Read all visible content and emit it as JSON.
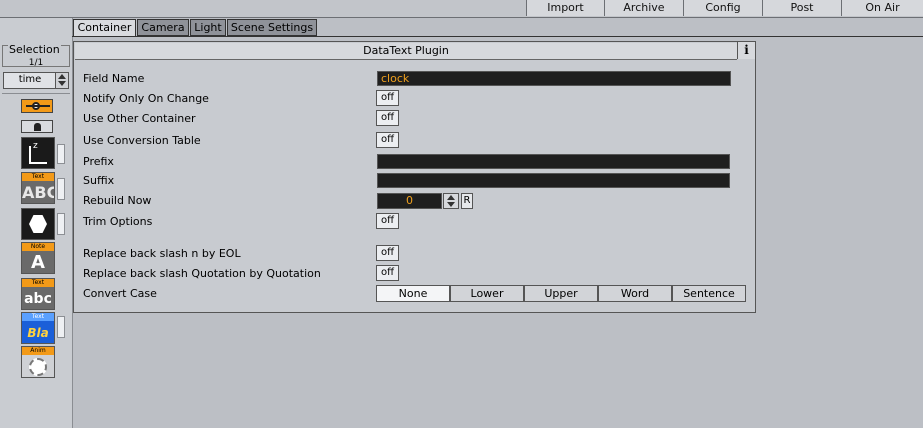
{
  "topbar": {
    "buttons": [
      "Import",
      "Archive",
      "Config",
      "Post",
      "On Air"
    ]
  },
  "left_panel": {
    "selection_label": "Selection",
    "selection_count": "1/1",
    "time_value": "time",
    "plugin_icons": [
      {
        "icon": "orange-key-icon"
      },
      {
        "icon": "container-icon"
      },
      {
        "icon": "axis-icon",
        "text": "z"
      },
      {
        "icon": "text-abc-icon",
        "tag": "Text",
        "text": "ABC"
      },
      {
        "icon": "hexagon-icon"
      },
      {
        "icon": "note-icon",
        "tag": "Note",
        "text": "A"
      },
      {
        "icon": "text-small-abc-icon",
        "tag": "Text",
        "text": "abc"
      },
      {
        "icon": "text-blabla-icon",
        "tag": "Text",
        "text": "Bla"
      },
      {
        "icon": "anim-icon",
        "tag": "Anim"
      }
    ]
  },
  "tabs": [
    {
      "label": "Container",
      "active": true
    },
    {
      "label": "Camera",
      "active": false
    },
    {
      "label": "Light",
      "active": false
    },
    {
      "label": "Scene Settings",
      "active": false
    }
  ],
  "plugin": {
    "title": "DataText Plugin",
    "info_label": "i",
    "field_name_label": "Field Name",
    "field_name_value": "clock",
    "notify_label": "Notify Only On Change",
    "notify_value": "off",
    "use_other_label": "Use Other Container",
    "use_other_value": "off",
    "conversion_label": "Use Conversion Table",
    "conversion_value": "off",
    "prefix_label": "Prefix",
    "prefix_value": "",
    "suffix_label": "Suffix",
    "suffix_value": "",
    "rebuild_label": "Rebuild Now",
    "rebuild_value": "0",
    "rebuild_reset": "R",
    "trim_label": "Trim Options",
    "trim_value": "off",
    "replace_eol_label": "Replace back slash n by EOL",
    "replace_eol_value": "off",
    "replace_quote_label": "Replace back slash Quotation by Quotation",
    "replace_quote_value": "off",
    "convert_case_label": "Convert Case",
    "case_options": [
      "None",
      "Lower",
      "Upper",
      "Word",
      "Sentence"
    ],
    "case_selected": "None"
  },
  "colors": {
    "accent": "#f0a01e",
    "field_bg": "#1f1f1f",
    "background": "#bcbfc5"
  }
}
